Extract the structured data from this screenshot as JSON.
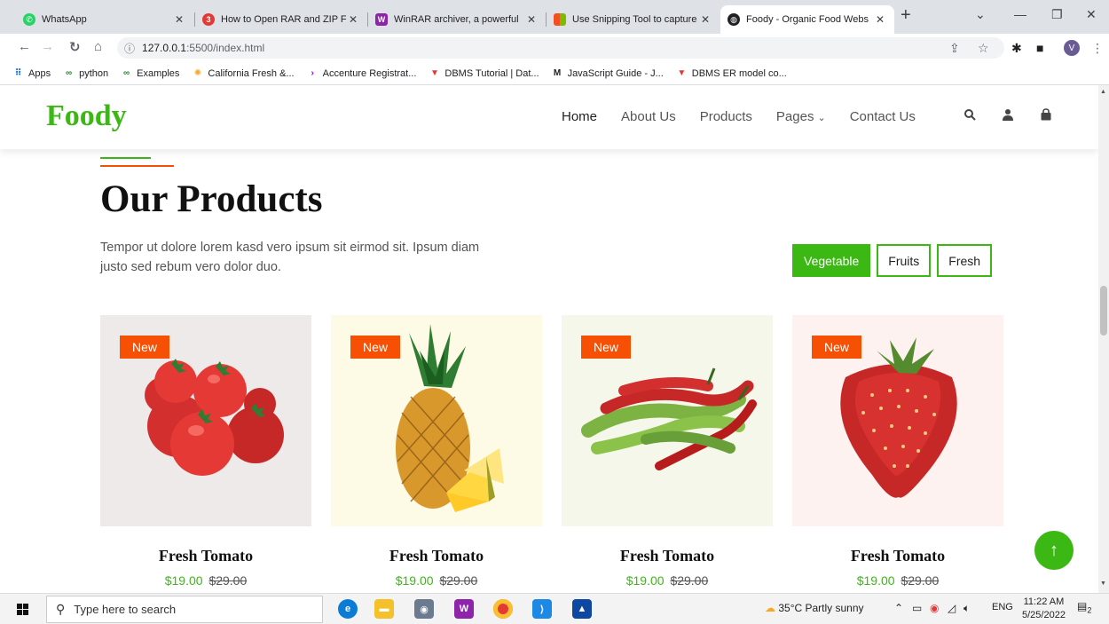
{
  "browser": {
    "tabs": [
      {
        "title": "WhatsApp",
        "icon": "whatsapp-icon",
        "color": "#25d366",
        "active": false
      },
      {
        "title": "How to Open RAR and ZIP Fi",
        "icon": "360-icon",
        "color": "#e53935",
        "active": false
      },
      {
        "title": "WinRAR archiver, a powerful",
        "icon": "winrar-icon",
        "color": "#8e24aa",
        "active": false
      },
      {
        "title": "Use Snipping Tool to capture",
        "icon": "microsoft-icon",
        "color": "#f25022",
        "active": false
      },
      {
        "title": "Foody - Organic Food Webs",
        "icon": "globe-icon",
        "color": "#202124",
        "active": true
      }
    ],
    "url_host": "127.0.0.1",
    "url_rest": ":5500/index.html",
    "avatar_letter": "V",
    "bookmarks": [
      {
        "label": "Apps",
        "icon": "apps-grid-icon",
        "glyph": "⠿",
        "color": "#1a73e8"
      },
      {
        "label": "python",
        "icon": "link-icon",
        "glyph": "∞",
        "color": "#2e7d32"
      },
      {
        "label": "Examples",
        "icon": "link-icon",
        "glyph": "∞",
        "color": "#2e7d32"
      },
      {
        "label": "California Fresh &...",
        "icon": "sun-icon",
        "glyph": "✺",
        "color": "#f9a825"
      },
      {
        "label": "Accenture Registrat...",
        "icon": "accenture-icon",
        "glyph": "›",
        "color": "#a100ff"
      },
      {
        "label": "DBMS Tutorial | Dat...",
        "icon": "triangle-logo-icon",
        "glyph": "▼",
        "color": "#e53935"
      },
      {
        "label": "JavaScript Guide - J...",
        "icon": "m-logo-icon",
        "glyph": "M",
        "color": "#202124"
      },
      {
        "label": "DBMS ER model co...",
        "icon": "triangle-logo-icon",
        "glyph": "▼",
        "color": "#e53935"
      }
    ]
  },
  "site": {
    "logo": "Foody",
    "nav": [
      "Home",
      "About Us",
      "Products",
      "Pages",
      "Contact Us"
    ],
    "active_nav": "Home",
    "section_title": "Our Products",
    "section_text": "Tempor ut dolore lorem kasd vero ipsum sit eirmod sit. Ipsum diam justo sed rebum vero dolor duo.",
    "filters": [
      "Vegetable",
      "Fruits",
      "Fresh"
    ],
    "active_filter": "Vegetable",
    "products": [
      {
        "badge": "New",
        "name": "Fresh Tomato",
        "price": "$19.00",
        "old_price": "$29.00",
        "image": "tomato-image",
        "bg": "#eeeaea"
      },
      {
        "badge": "New",
        "name": "Fresh Tomato",
        "price": "$19.00",
        "old_price": "$29.00",
        "image": "pineapple-image",
        "bg": "#fdfbe6"
      },
      {
        "badge": "New",
        "name": "Fresh Tomato",
        "price": "$19.00",
        "old_price": "$29.00",
        "image": "chili-image",
        "bg": "#f5f7ea"
      },
      {
        "badge": "New",
        "name": "Fresh Tomato",
        "price": "$19.00",
        "old_price": "$29.00",
        "image": "strawberry-image",
        "bg": "#fdf2f0"
      }
    ],
    "colors": {
      "primary": "#3cb815",
      "secondary": "#f65005"
    }
  },
  "taskbar": {
    "search_placeholder": "Type here to search",
    "weather": "35°C  Partly sunny",
    "lang": "ENG",
    "time": "11:22 AM",
    "date": "5/25/2022",
    "notif_count": "2"
  }
}
